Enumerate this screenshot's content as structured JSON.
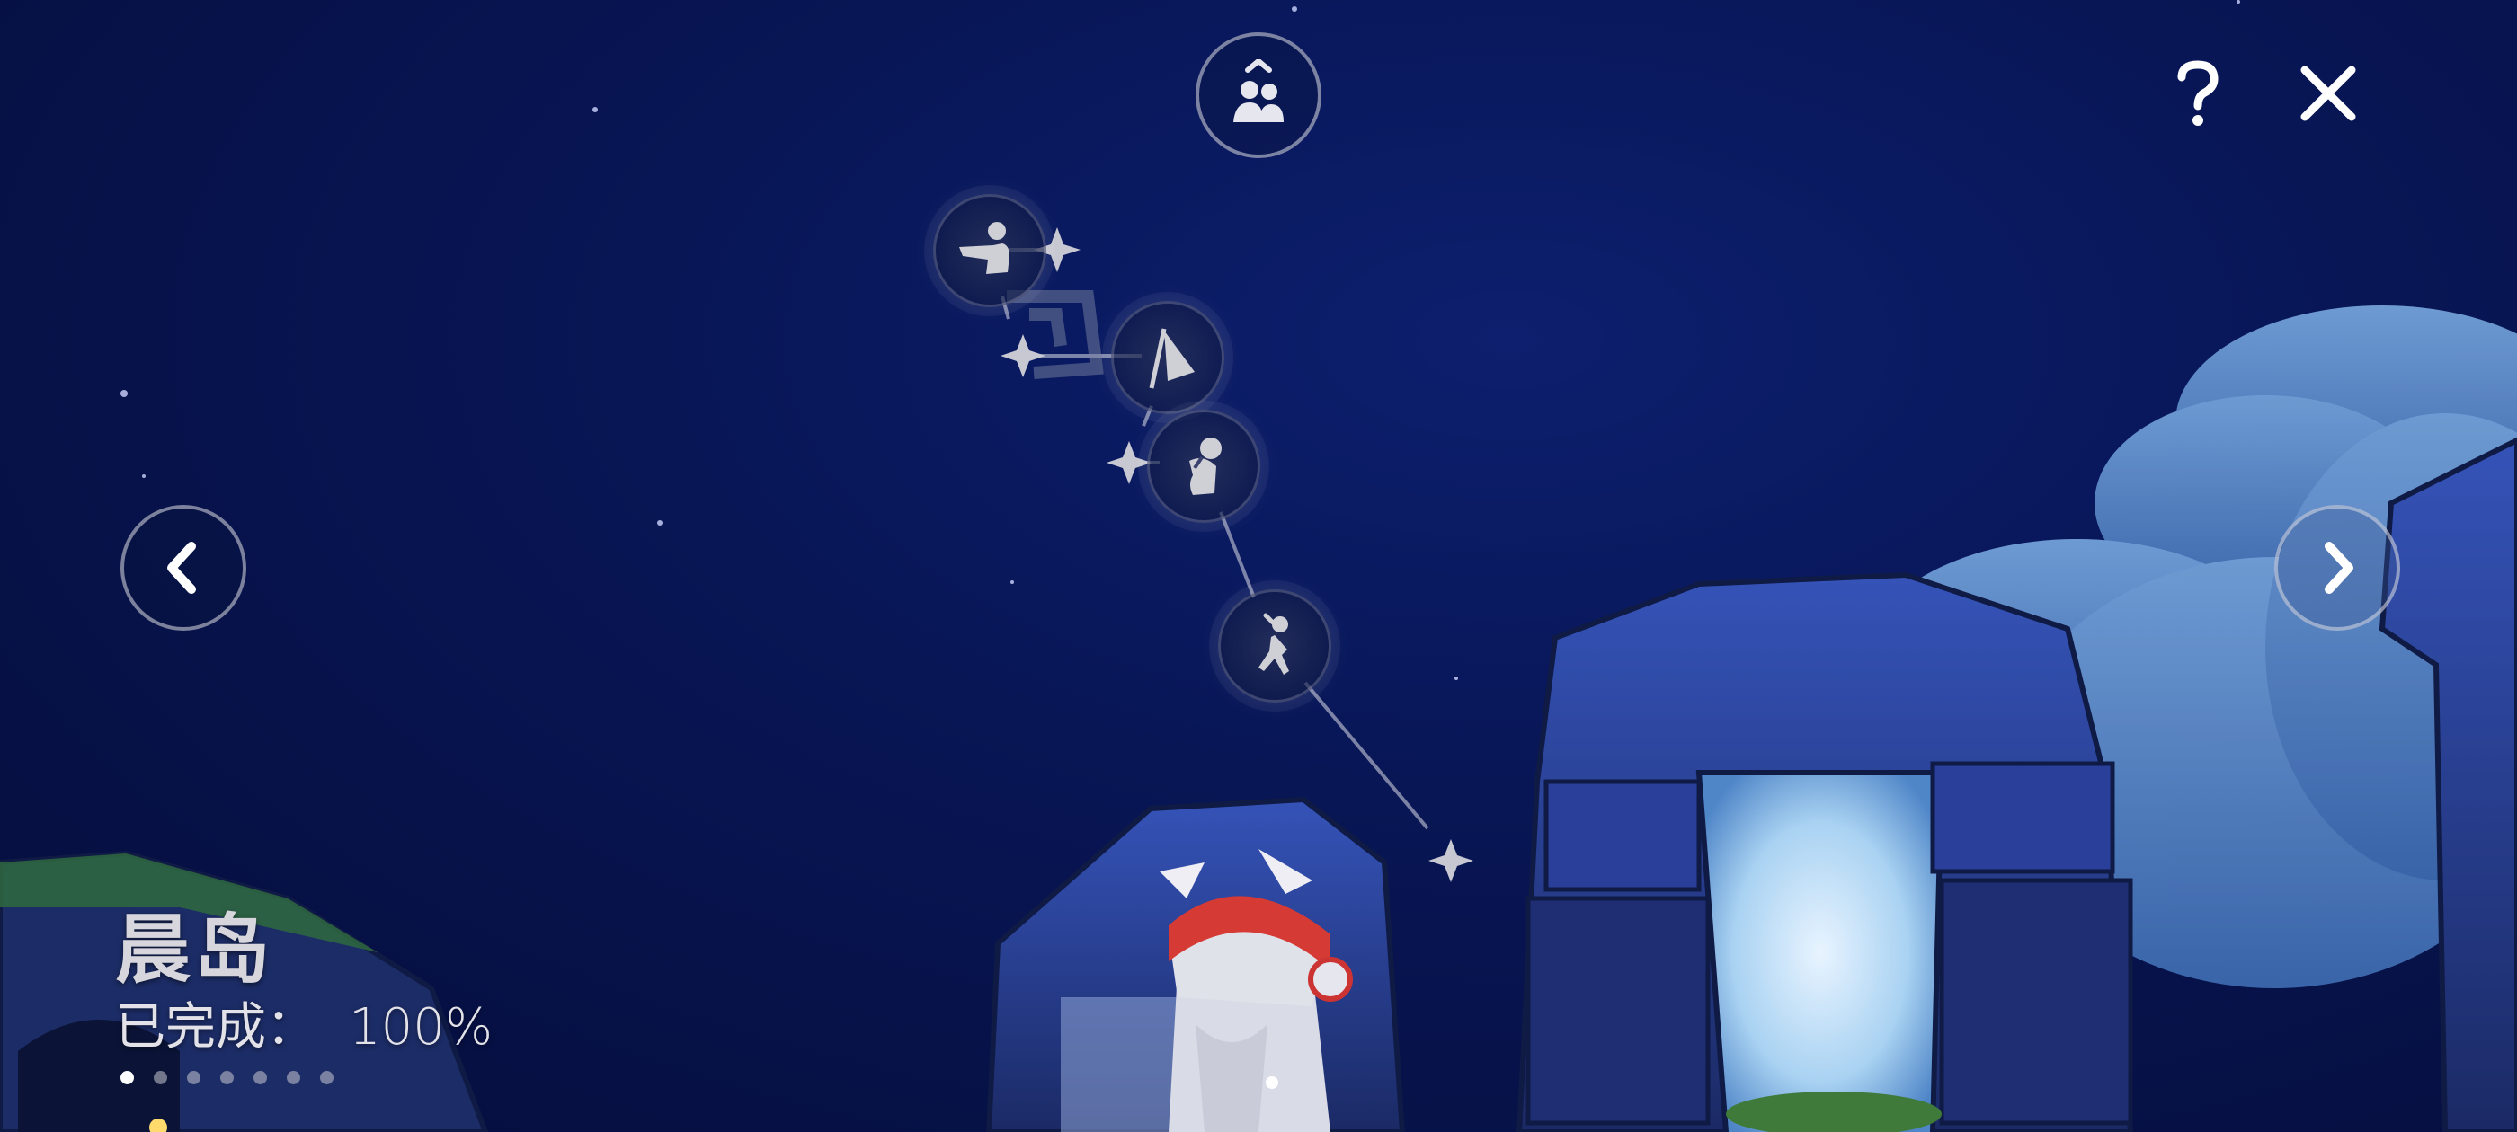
{
  "region": {
    "title": "晨岛",
    "progress_label": "已完成：",
    "progress_value": "100%"
  },
  "pagination": {
    "total": 7,
    "active_index": 0
  },
  "top_bar": {
    "friends_icon": "friends-icon",
    "help_icon": "question-icon",
    "close_icon": "close-icon"
  },
  "navigation": {
    "prev_icon": "chevron-left-icon",
    "next_icon": "chevron-right-icon"
  },
  "constellation": {
    "spirits": [
      {
        "name": "pointing-spirit-icon",
        "unlocked": true
      },
      {
        "name": "flag-spirit-icon",
        "unlocked": true
      },
      {
        "name": "bowing-spirit-icon",
        "unlocked": true
      },
      {
        "name": "running-spirit-icon",
        "unlocked": true
      }
    ]
  },
  "colors": {
    "sky_top": "#050d3a",
    "sky_mid": "#0d1f6e",
    "ui_stroke": "#dcdce6",
    "cloud": "#5f8fcf"
  }
}
